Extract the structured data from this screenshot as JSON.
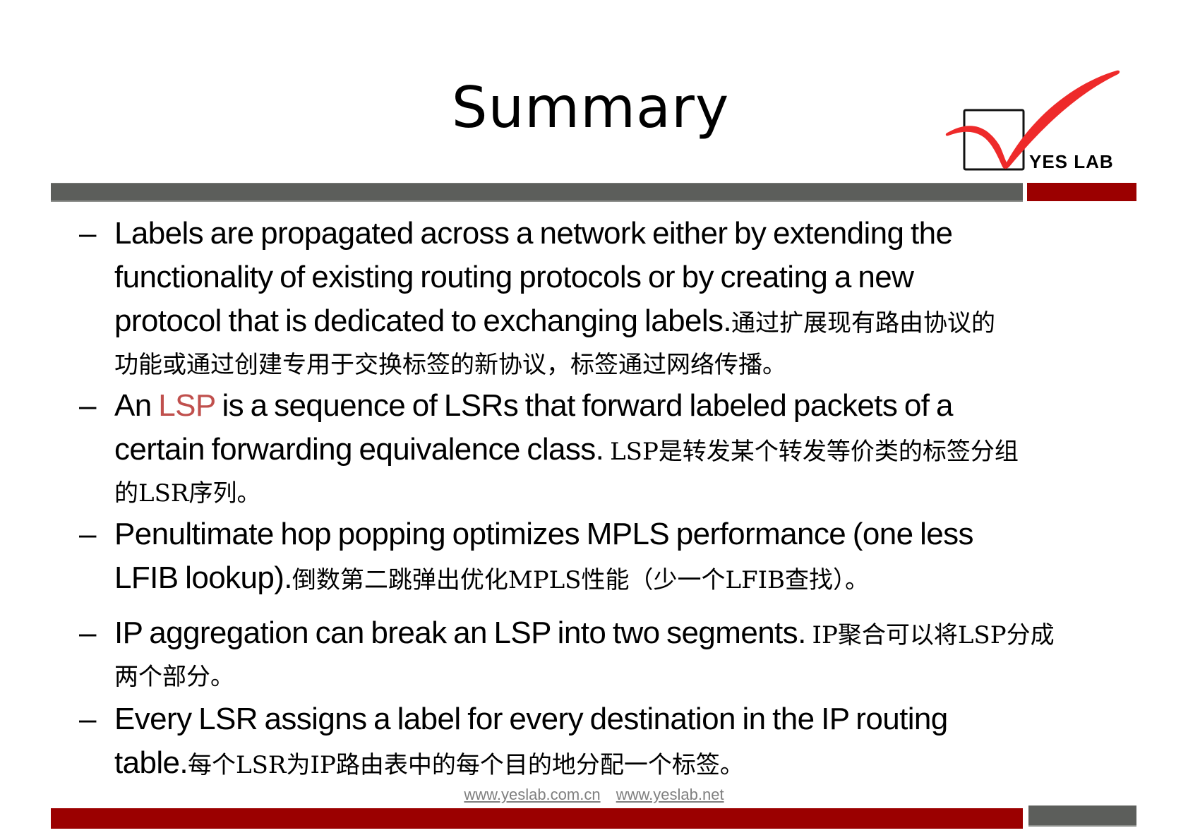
{
  "slide": {
    "title": "Summary",
    "logo": {
      "text": "YES LAB",
      "icon": "checkmark-box-icon",
      "check_color": "#ee2a2a"
    },
    "accent_colors": {
      "gray_bar": "#5c5e5b",
      "red_bar": "#9b0000",
      "highlight": "#c0504d"
    },
    "bullets": [
      {
        "marker": "–",
        "lines": [
          "Labels are propagated across a network either by  extending the",
          "functionality of existing routing protocols or  by creating a new"
        ],
        "mixed_line": {
          "en": "protocol that is dedicated to exchanging  labels.",
          "cn": "通过扩展现有路由协议的"
        },
        "cn_lines": [
          "功能或通过创建专用于交换标签的新协议，标签通过网络传播。"
        ]
      },
      {
        "marker": "–",
        "line1": {
          "prefix": "An ",
          "highlight": "LSP",
          "suffix": " is a sequence of LSRs that forward labeled packets  of a"
        },
        "mixed_line": {
          "en": "certain forwarding equivalence class.",
          "cn": " LSP是转发某个转发等价类的标签分组"
        },
        "cn_lines": [
          "的LSR序列。"
        ]
      },
      {
        "marker": "–",
        "lines": [
          "Penultimate hop popping optimizes MPLS performance  (one less"
        ],
        "mixed_line": {
          "en": "LFIB lookup).",
          "cn": "倒数第二跳弹出优化MPLS性能（少一个LFIB查找）。"
        }
      },
      {
        "marker": "–",
        "mixed_line": {
          "en": "IP aggregation can break an LSP into two segments.",
          "cn": " IP聚合可以将LSP分成"
        },
        "cn_lines": [
          "两个部分。"
        ]
      },
      {
        "marker": "–",
        "lines": [
          "Every LSR assigns a label for every destination in the IP  routing"
        ],
        "mixed_line": {
          "en": "table.",
          "cn": "每个LSR为IP路由表中的每个目的地分配一个标签。"
        }
      }
    ],
    "footer": {
      "links": [
        "www.yeslab.com.cn",
        "www.yeslab.net"
      ]
    }
  }
}
